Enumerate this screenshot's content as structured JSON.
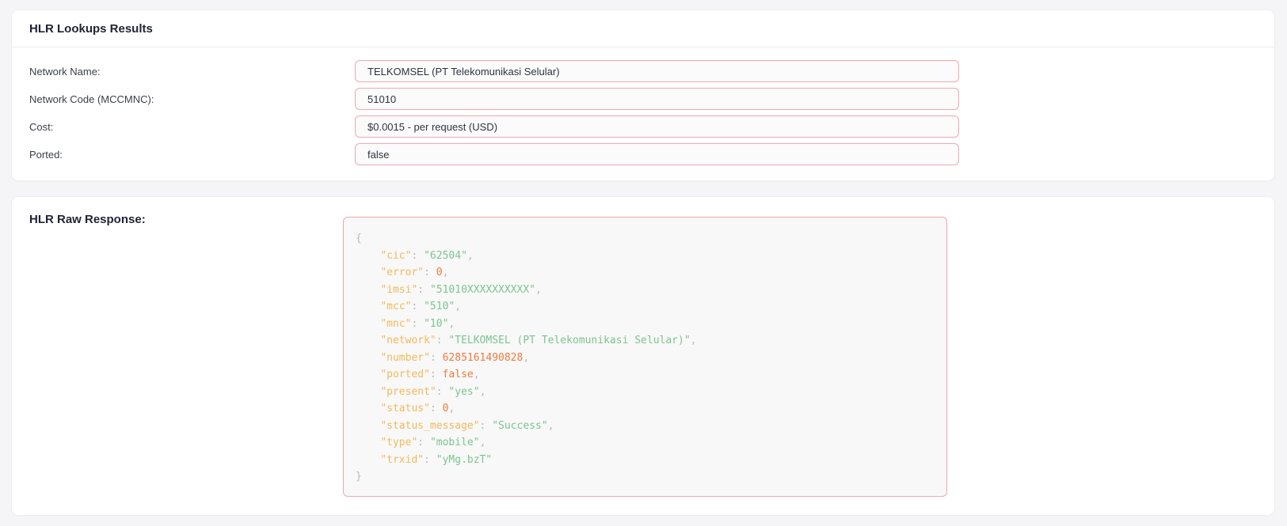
{
  "results_card": {
    "title": "HLR Lookups Results",
    "rows": [
      {
        "label": "Network Name:",
        "value": "TELKOMSEL (PT Telekomunikasi Selular)"
      },
      {
        "label": "Network Code (MCCMNC):",
        "value": "51010"
      },
      {
        "label": "Cost:",
        "value": "$0.0015 - per request (USD)"
      },
      {
        "label": "Ported:",
        "value": "false"
      }
    ]
  },
  "raw_card": {
    "title": "HLR Raw Response:",
    "open_brace": "{",
    "close_brace": "}",
    "lines": [
      {
        "key": "\"cic\"",
        "value": "\"62504\"",
        "type": "str",
        "comma": true
      },
      {
        "key": "\"error\"",
        "value": "0",
        "type": "num",
        "comma": true
      },
      {
        "key": "\"imsi\"",
        "value": "\"51010XXXXXXXXXX\"",
        "type": "str",
        "comma": true
      },
      {
        "key": "\"mcc\"",
        "value": "\"510\"",
        "type": "str",
        "comma": true
      },
      {
        "key": "\"mnc\"",
        "value": "\"10\"",
        "type": "str",
        "comma": true
      },
      {
        "key": "\"network\"",
        "value": "\"TELKOMSEL (PT Telekomunikasi Selular)\"",
        "type": "str",
        "comma": true
      },
      {
        "key": "\"number\"",
        "value": "6285161490828",
        "type": "num",
        "comma": true
      },
      {
        "key": "\"ported\"",
        "value": "false",
        "type": "bool",
        "comma": true
      },
      {
        "key": "\"present\"",
        "value": "\"yes\"",
        "type": "str",
        "comma": true
      },
      {
        "key": "\"status\"",
        "value": "0",
        "type": "num",
        "comma": true
      },
      {
        "key": "\"status_message\"",
        "value": "\"Success\"",
        "type": "str",
        "comma": true
      },
      {
        "key": "\"type\"",
        "value": "\"mobile\"",
        "type": "str",
        "comma": true
      },
      {
        "key": "\"trxid\"",
        "value": "\"yMg.bzT\"",
        "type": "str",
        "comma": false
      }
    ]
  }
}
